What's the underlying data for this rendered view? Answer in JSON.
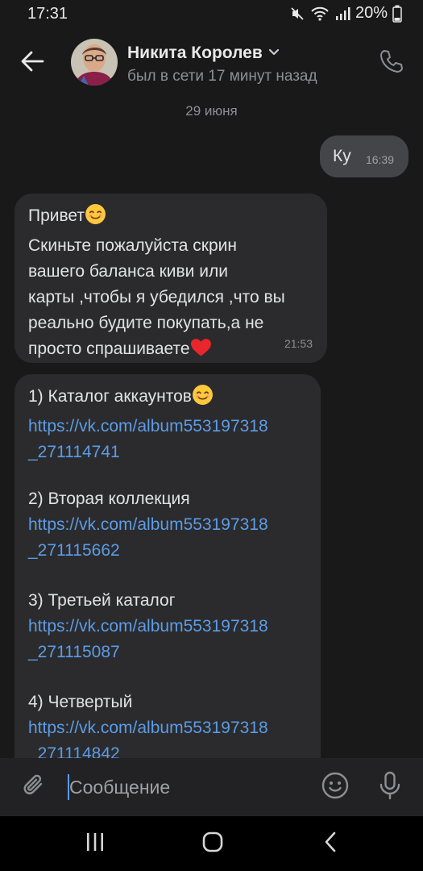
{
  "status_bar": {
    "time": "17:31",
    "battery": "20%",
    "icons": [
      "mute-icon",
      "wifi-icon",
      "signal-icon",
      "battery-icon"
    ]
  },
  "header": {
    "contact_name": "Никита Королев",
    "contact_status": "был в сети 17 минут назад",
    "icons": [
      "back-arrow-icon",
      "chevron-down-icon",
      "phone-icon"
    ]
  },
  "chat": {
    "date_separator": "29 июня",
    "messages": [
      {
        "direction": "out",
        "text": "Ку",
        "time": "16:39"
      },
      {
        "direction": "in",
        "greeting": "Привет",
        "body": "Скиньте пожалуйста скрин\nвашего баланса киви или\nкарты ,чтобы я убедился ,что вы\nреально будите покупать,а не\nпросто спрашиваете",
        "time": "21:53",
        "emojis": [
          "smiling-face-emoji",
          "red-heart-emoji"
        ]
      },
      {
        "direction": "in",
        "items": [
          {
            "title": "1) Каталог аккаунтов",
            "link": "https://vk.com/album553197318_271114741",
            "link_line1": "https://vk.com/album553197318",
            "link_line2": "_271114741"
          },
          {
            "title": "2) Вторая коллекция",
            "link": "https://vk.com/album553197318_271115662",
            "link_line1": "https://vk.com/album553197318",
            "link_line2": "_271115662"
          },
          {
            "title": "3) Третьей каталог",
            "link": "https://vk.com/album553197318_271115087",
            "link_line1": "https://vk.com/album553197318",
            "link_line2": "_271115087"
          },
          {
            "title": "4) Четвертый",
            "link": "https://vk.com/album553197318_271114842",
            "link_line1": "https://vk.com/album553197318",
            "link_line2": "_271114842"
          }
        ]
      }
    ]
  },
  "composer": {
    "placeholder": "Сообщение",
    "icons": [
      "paperclip-icon",
      "emoji-smile-icon",
      "microphone-icon"
    ]
  },
  "nav_bar": {
    "icons": [
      "recents-icon",
      "home-icon",
      "back-chevron-icon"
    ]
  },
  "colors": {
    "background": "#19191a",
    "incoming_bubble": "#2b2b2d",
    "outgoing_bubble": "#444549",
    "link": "#5c9ce6",
    "secondary_text": "#8d8f94"
  }
}
